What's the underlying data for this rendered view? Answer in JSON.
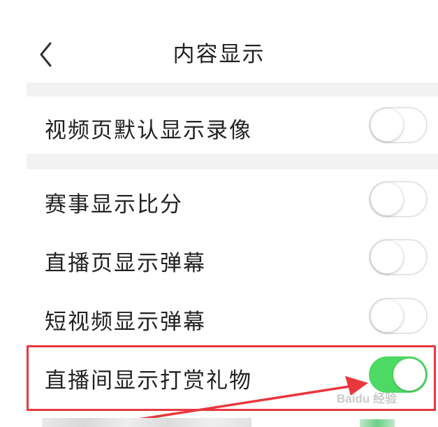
{
  "header": {
    "title": "内容显示",
    "back_icon": "chevron-left-icon"
  },
  "settings": [
    {
      "label": "视频页默认显示录像",
      "enabled": false
    },
    {
      "label": "赛事显示比分",
      "enabled": false
    },
    {
      "label": "直播页显示弹幕",
      "enabled": false
    },
    {
      "label": "短视频显示弹幕",
      "enabled": false
    },
    {
      "label": "直播间显示打赏礼物",
      "enabled": true
    }
  ],
  "annotation": {
    "highlight_color": "#e8383d",
    "arrow_color": "#e8383d"
  },
  "watermark": {
    "text": "Baidu 经验"
  },
  "colors": {
    "toggle_on": "#4cd964",
    "section_gap": "#f2f2f2",
    "text": "#222222"
  }
}
